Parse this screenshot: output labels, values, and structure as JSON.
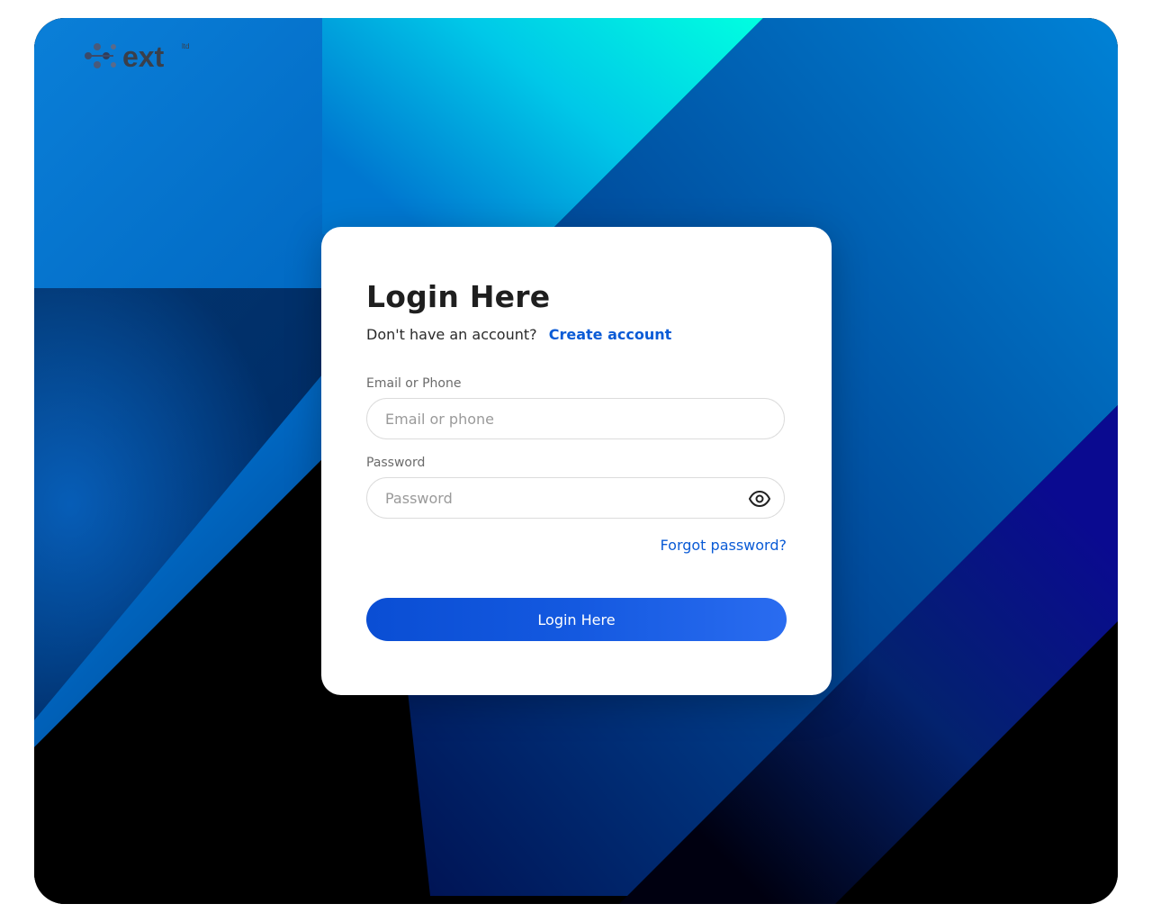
{
  "brand": {
    "logo_text": "ext",
    "logo_superscript": "ltd",
    "colors": {
      "accent": "#0a5bd6",
      "button_start": "#0a4ed4",
      "button_end": "#2a6cf0",
      "background_cyan": "#00ffe0",
      "background_blue": "#0077cc",
      "background_navy": "#0a0a8a"
    }
  },
  "login_card": {
    "title": "Login Here",
    "prompt_text": "Don't have an account?",
    "create_account_link": "Create account",
    "email": {
      "label": "Email or Phone",
      "placeholder": "Email or phone",
      "value": ""
    },
    "password": {
      "label": "Password",
      "placeholder": "Password",
      "value": "",
      "toggle_icon": "eye-icon"
    },
    "forgot_password_link": "Forgot password?",
    "submit_label": "Login Here"
  }
}
